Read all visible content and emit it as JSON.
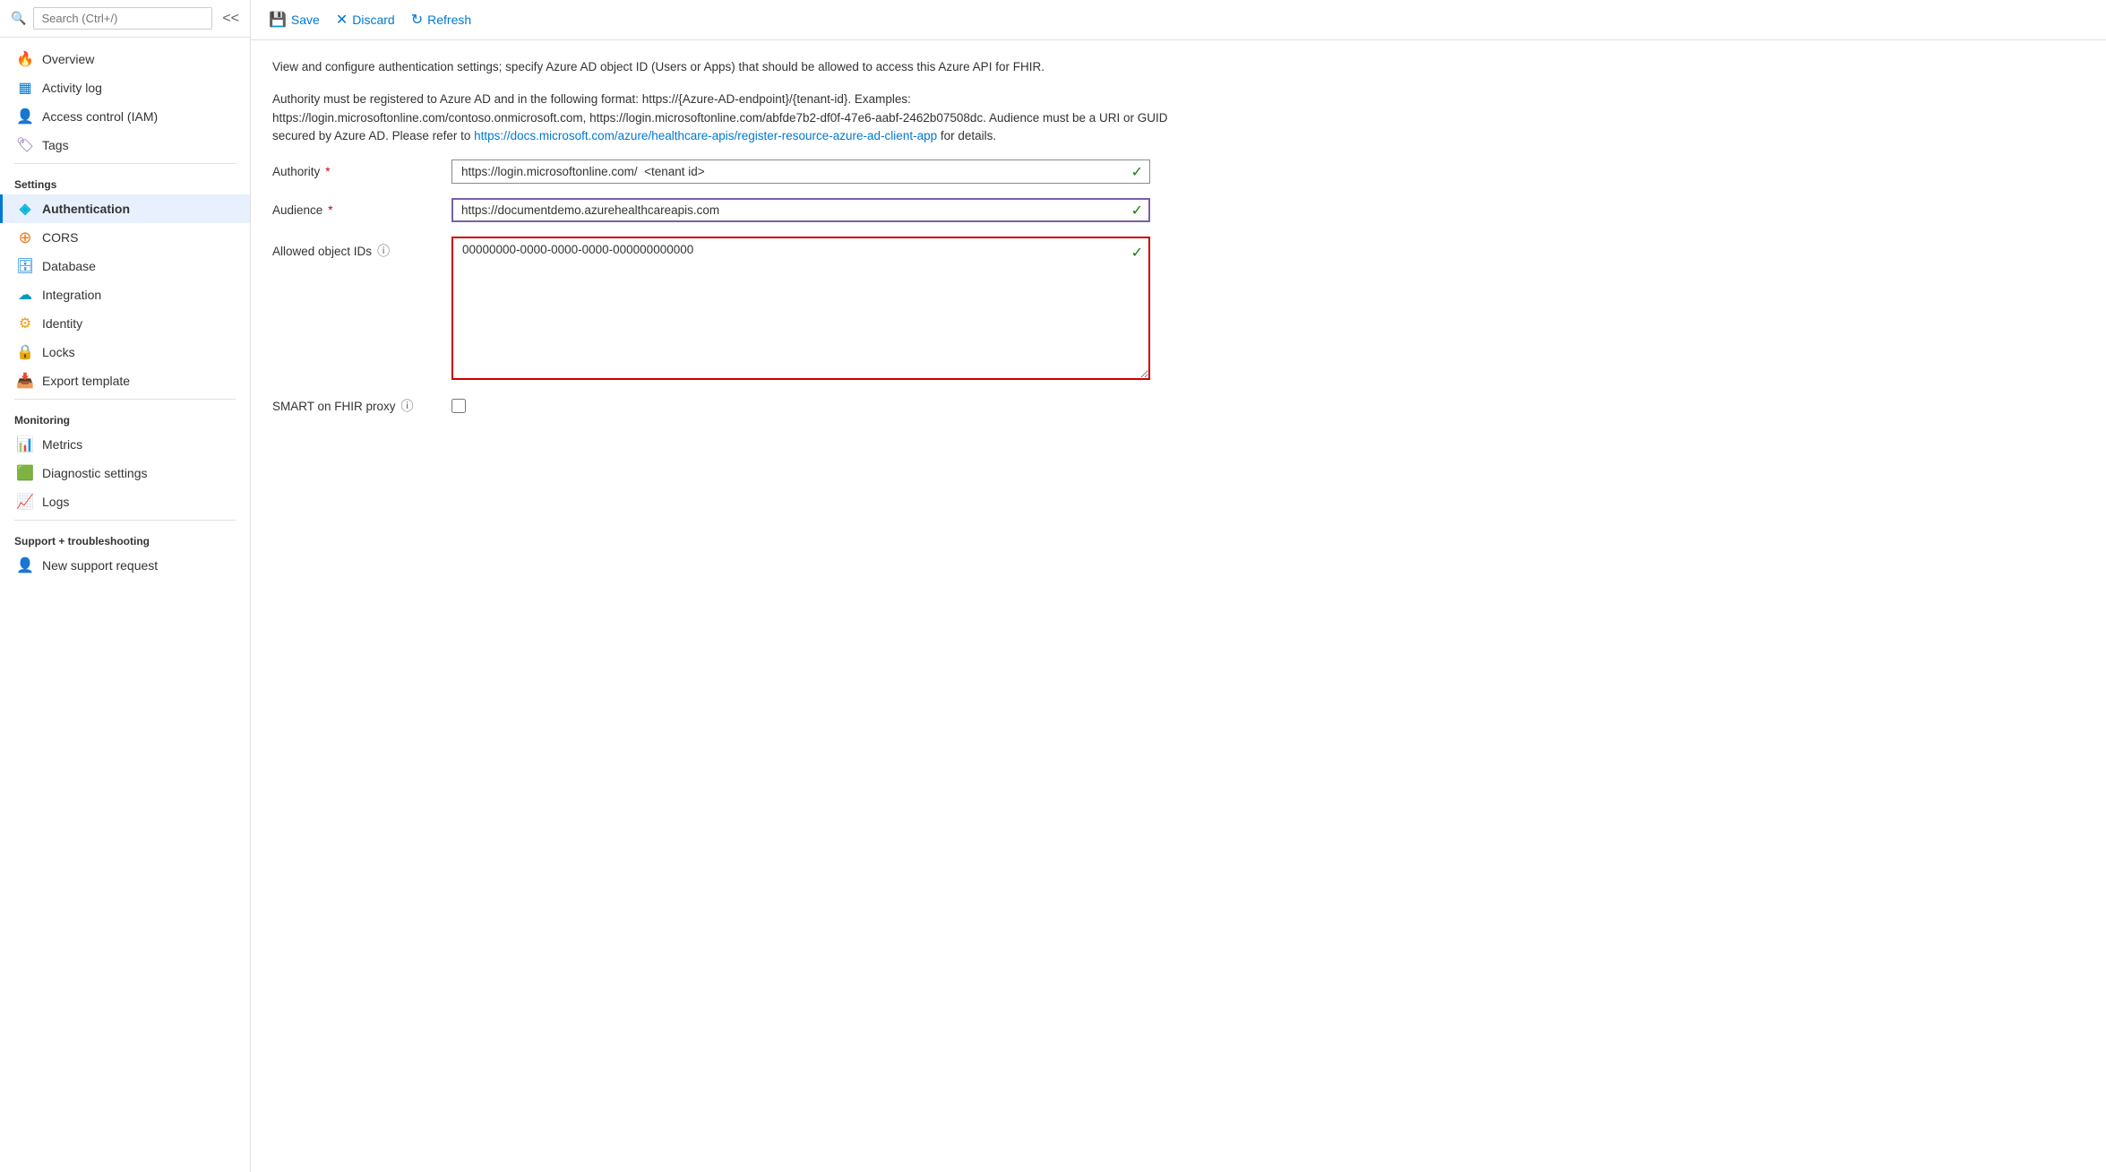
{
  "sidebar": {
    "search_placeholder": "Search (Ctrl+/)",
    "collapse_label": "<<",
    "nav_items": [
      {
        "id": "overview",
        "label": "Overview",
        "icon": "🔥",
        "icon_class": "icon-overview",
        "active": false
      },
      {
        "id": "activity-log",
        "label": "Activity log",
        "icon": "📋",
        "icon_class": "icon-activity",
        "active": false
      },
      {
        "id": "access-control",
        "label": "Access control (IAM)",
        "icon": "👤",
        "icon_class": "icon-access",
        "active": false
      },
      {
        "id": "tags",
        "label": "Tags",
        "icon": "🏷",
        "icon_class": "icon-tags",
        "active": false
      }
    ],
    "settings_label": "Settings",
    "settings_items": [
      {
        "id": "authentication",
        "label": "Authentication",
        "icon": "◈",
        "icon_class": "icon-auth",
        "active": true
      },
      {
        "id": "cors",
        "label": "CORS",
        "icon": "⊕",
        "icon_class": "icon-cors",
        "active": false
      },
      {
        "id": "database",
        "label": "Database",
        "icon": "🗄",
        "icon_class": "icon-database",
        "active": false
      },
      {
        "id": "integration",
        "label": "Integration",
        "icon": "☁",
        "icon_class": "icon-integration",
        "active": false
      },
      {
        "id": "identity",
        "label": "Identity",
        "icon": "⚙",
        "icon_class": "icon-identity",
        "active": false
      },
      {
        "id": "locks",
        "label": "Locks",
        "icon": "🔒",
        "icon_class": "icon-locks",
        "active": false
      },
      {
        "id": "export-template",
        "label": "Export template",
        "icon": "📥",
        "icon_class": "icon-export",
        "active": false
      }
    ],
    "monitoring_label": "Monitoring",
    "monitoring_items": [
      {
        "id": "metrics",
        "label": "Metrics",
        "icon": "📊",
        "icon_class": "icon-metrics",
        "active": false
      },
      {
        "id": "diagnostic",
        "label": "Diagnostic settings",
        "icon": "🟩",
        "icon_class": "icon-diagnostic",
        "active": false
      },
      {
        "id": "logs",
        "label": "Logs",
        "icon": "📈",
        "icon_class": "icon-logs",
        "active": false
      }
    ],
    "support_label": "Support + troubleshooting",
    "support_items": [
      {
        "id": "new-support",
        "label": "New support request",
        "icon": "👤",
        "icon_class": "icon-support",
        "active": false
      }
    ]
  },
  "toolbar": {
    "save_label": "Save",
    "discard_label": "Discard",
    "refresh_label": "Refresh"
  },
  "content": {
    "description1": "View and configure authentication settings; specify Azure AD object ID (Users or Apps) that should be allowed to access this Azure API for FHIR.",
    "description2": "Authority must be registered to Azure AD and in the following format: https://{Azure-AD-endpoint}/{tenant-id}. Examples: https://login.microsoftonline.com/contoso.onmicrosoft.com, https://login.microsoftonline.com/abfde7b2-df0f-47e6-aabf-2462b07508dc. Audience must be a URI or GUID secured by Azure AD. Please refer to ",
    "description_link_text": "https://docs.microsoft.com/azure/healthcare-apis/register-resource-azure-ad-client-app",
    "description_link_url": "#",
    "description3": " for details.",
    "authority_label": "Authority",
    "authority_value": "https://login.microsoftonline.com/  <tenant id>",
    "audience_label": "Audience",
    "audience_value": "https://documentdemo.azurehealthcareapis.com",
    "allowed_ids_label": "Allowed object IDs",
    "allowed_ids_value": "00000000-0000-0000-0000-000000000000",
    "smart_proxy_label": "SMART on FHIR proxy"
  }
}
